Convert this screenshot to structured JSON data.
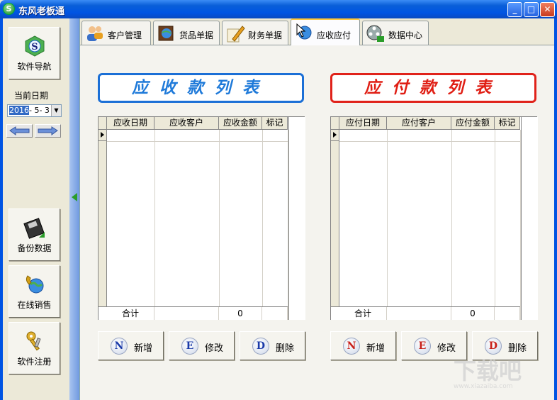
{
  "window": {
    "title": "东风老板通",
    "app_icon": "S",
    "minimize": "_",
    "maximize": "□",
    "close": "✕"
  },
  "sidebar": {
    "nav_button": "软件导航",
    "date_label": "当前日期",
    "date_value": {
      "year": "2016",
      "rest": "- 5- 3"
    },
    "backup_button": "备份数据",
    "sales_button": "在线销售",
    "register_button": "软件注册"
  },
  "tabs": [
    {
      "label": "客户管理"
    },
    {
      "label": "货品单据"
    },
    {
      "label": "财务单据"
    },
    {
      "label": "应收应付",
      "active": true
    },
    {
      "label": "数据中心"
    }
  ],
  "receivable": {
    "banner": "应收款列表",
    "columns": [
      "应收日期",
      "应收客户",
      "应收金额",
      "标记"
    ],
    "footer_label": "合计",
    "footer_total": "0"
  },
  "payable": {
    "banner": "应付款列表",
    "columns": [
      "应付日期",
      "应付客户",
      "应付金额",
      "标记"
    ],
    "footer_label": "合计",
    "footer_total": "0"
  },
  "actions": {
    "add": {
      "key": "N",
      "label": "新增"
    },
    "edit": {
      "key": "E",
      "label": "修改"
    },
    "delete": {
      "key": "D",
      "label": "删除"
    }
  },
  "watermark": {
    "main": "下载吧",
    "sub": "www.xiazaiba.com"
  },
  "colors": {
    "titlebar": "#0054e3",
    "receivable_accent": "#1b6fd6",
    "payable_accent": "#e0221a"
  }
}
